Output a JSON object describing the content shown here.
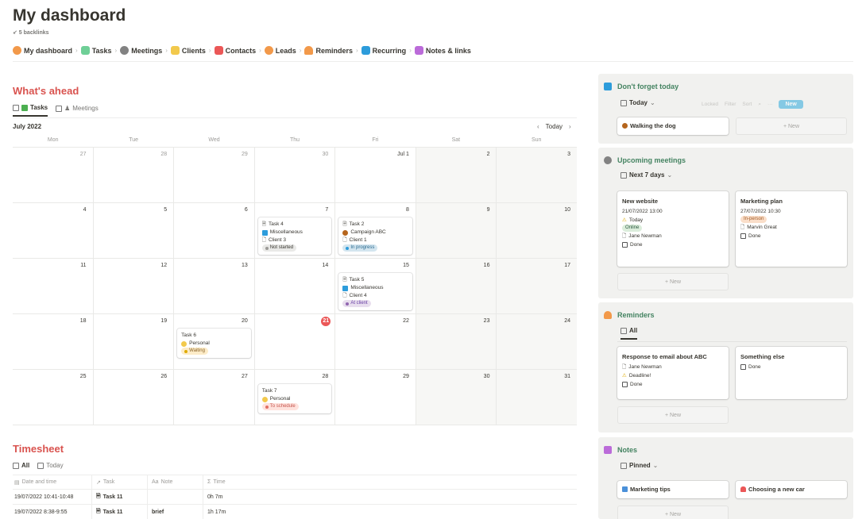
{
  "page": {
    "title": "My dashboard",
    "backlinks": "↙ 5 backlinks"
  },
  "nav": [
    {
      "label": "My dashboard",
      "color": "#f2994a"
    },
    {
      "label": "Tasks",
      "color": "#6fcf97"
    },
    {
      "label": "Meetings",
      "color": "#828282"
    },
    {
      "label": "Clients",
      "color": "#f2c94c"
    },
    {
      "label": "Contacts",
      "color": "#eb5757"
    },
    {
      "label": "Leads",
      "color": "#f2994a"
    },
    {
      "label": "Reminders",
      "color": "#f2994a"
    },
    {
      "label": "Recurring",
      "color": "#2d9cdb"
    },
    {
      "label": "Notes & links",
      "color": "#bb6bd9"
    }
  ],
  "ahead": {
    "title": "What's ahead",
    "tab_tasks": "Tasks",
    "tab_meetings": "Meetings",
    "month": "July 2022",
    "today_btn": "Today",
    "prev": "‹",
    "next": "›",
    "daynames": [
      "Mon",
      "Tue",
      "Wed",
      "Thu",
      "Fri",
      "Sat",
      "Sun"
    ],
    "weeks": [
      [
        "27",
        "28",
        "29",
        "30",
        "Jul 1",
        "2",
        "3"
      ],
      [
        "4",
        "5",
        "6",
        "7",
        "8",
        "9",
        "10"
      ],
      [
        "11",
        "12",
        "13",
        "14",
        "15",
        "16",
        "17"
      ],
      [
        "18",
        "19",
        "20",
        "21",
        "22",
        "23",
        "24"
      ],
      [
        "25",
        "26",
        "27",
        "28",
        "29",
        "30",
        "31"
      ]
    ],
    "events": {
      "task4": {
        "name": "Task 4",
        "cat": "Miscellaneous",
        "client": "Client 3",
        "status": "Not started"
      },
      "task2": {
        "name": "Task 2",
        "cat": "Campaign ABC",
        "client": "Client 1",
        "status": "In progress"
      },
      "task5": {
        "name": "Task 5",
        "cat": "Miscellaneous",
        "client": "Client 4",
        "status": "At client"
      },
      "task6": {
        "name": "Task 6",
        "cat": "Personal",
        "status": "Waiting"
      },
      "task7": {
        "name": "Task 7",
        "cat": "Personal",
        "status": "To schedule"
      }
    }
  },
  "timesheet": {
    "title": "Timesheet",
    "tab_all": "All",
    "tab_today": "Today",
    "headers": [
      "Date and time",
      "Task",
      "Note",
      "Time"
    ],
    "header_icons": [
      "▤",
      "↗",
      "Aa",
      "Σ"
    ],
    "rows": [
      {
        "date": "19/07/2022 10:41-10:48",
        "task": "Task 11",
        "note": "",
        "time": "0h 7m"
      },
      {
        "date": "19/07/2022 8:38-9:55",
        "task": "Task 11",
        "note": "brief",
        "time": "1h 17m"
      }
    ]
  },
  "forget": {
    "title": "Don't forget today",
    "view": "Today",
    "toolbar": [
      "Locked",
      "Filter",
      "Sort"
    ],
    "new_label": "New",
    "card": "Walking the dog",
    "add": "+ New"
  },
  "meetings": {
    "title": "Upcoming meetings",
    "view": "Next 7 days",
    "cards": [
      {
        "title": "New website",
        "date": "21/07/2022 13:00",
        "flag": "Today",
        "mode": "Online",
        "person": "Jane Newman",
        "done": "Done"
      },
      {
        "title": "Marketing plan",
        "date": "27/07/2022 10:30",
        "mode": "In-person",
        "person": "Marvin Great",
        "done": "Done"
      }
    ],
    "add": "+ New"
  },
  "reminders": {
    "title": "Reminders",
    "view": "All",
    "cards": [
      {
        "title": "Response to email about ABC",
        "person": "Jane Newman",
        "flag": "Deadline!",
        "done": "Done"
      },
      {
        "title": "Something else",
        "done": "Done"
      }
    ],
    "add": "+ New"
  },
  "notes": {
    "title": "Notes",
    "view": "Pinned",
    "cards": [
      "Marketing tips",
      "Choosing a new car"
    ],
    "add": "+ New"
  }
}
